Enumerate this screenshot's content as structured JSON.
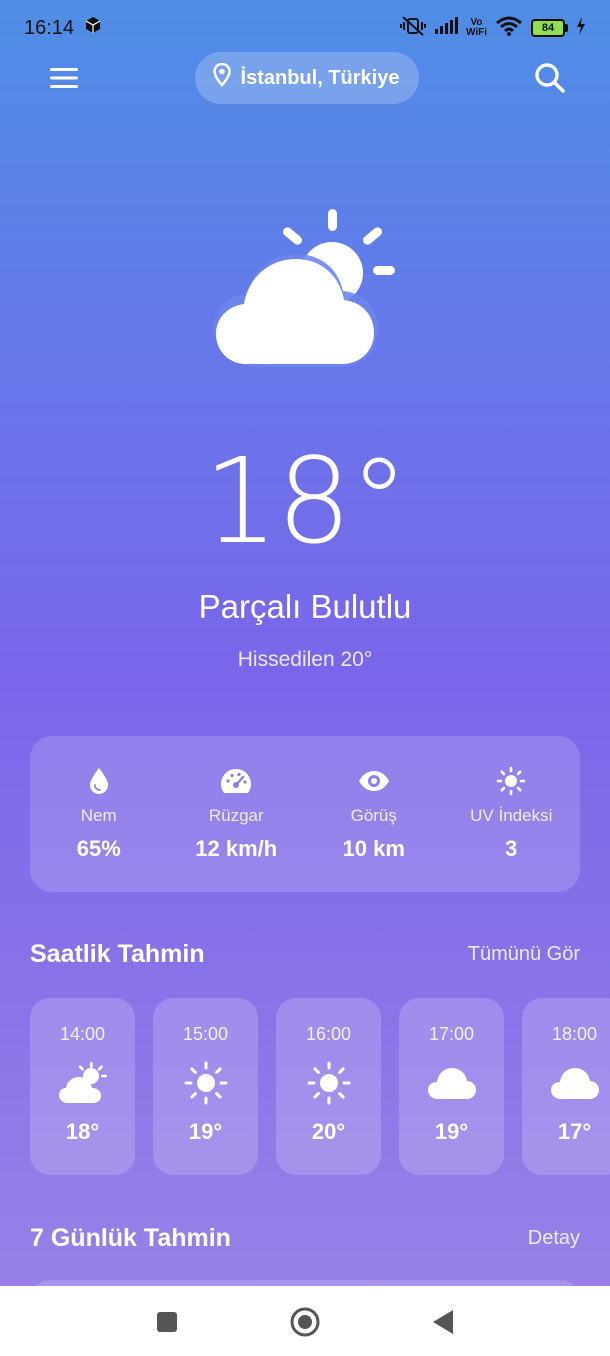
{
  "status_bar": {
    "time": "16:14",
    "battery": "84",
    "vo_label": "Vo",
    "wifi_label": "WiFi"
  },
  "header": {
    "location": "İstanbul, Türkiye",
    "menu_icon": "hamburger-menu-icon",
    "search_icon": "search-icon",
    "location_icon": "location-pin-icon"
  },
  "current": {
    "icon": "partly-cloudy-icon",
    "temperature": "18°",
    "condition": "Parçalı Bulutlu",
    "feels_like": "Hissedilen 20°"
  },
  "stats": [
    {
      "icon": "humidity-drop-icon",
      "label": "Nem",
      "value": "65%"
    },
    {
      "icon": "wind-gauge-icon",
      "label": "Rüzgar",
      "value": "12 km/h"
    },
    {
      "icon": "eye-icon",
      "label": "Görüş",
      "value": "10 km"
    },
    {
      "icon": "sun-uv-icon",
      "label": "UV İndeksi",
      "value": "3"
    }
  ],
  "hourly": {
    "title": "Saatlik Tahmin",
    "link": "Tümünü Gör",
    "items": [
      {
        "time": "14:00",
        "icon": "partly-cloudy-icon",
        "temp": "18°"
      },
      {
        "time": "15:00",
        "icon": "sun-icon",
        "temp": "19°"
      },
      {
        "time": "16:00",
        "icon": "sun-icon",
        "temp": "20°"
      },
      {
        "time": "17:00",
        "icon": "cloud-icon",
        "temp": "19°"
      },
      {
        "time": "18:00",
        "icon": "cloud-icon",
        "temp": "17°"
      }
    ]
  },
  "daily": {
    "title": "7 Günlük Tahmin",
    "link": "Detay"
  },
  "nav": {
    "recents_icon": "recents-square-icon",
    "home_icon": "home-circle-icon",
    "back_icon": "back-triangle-icon"
  }
}
